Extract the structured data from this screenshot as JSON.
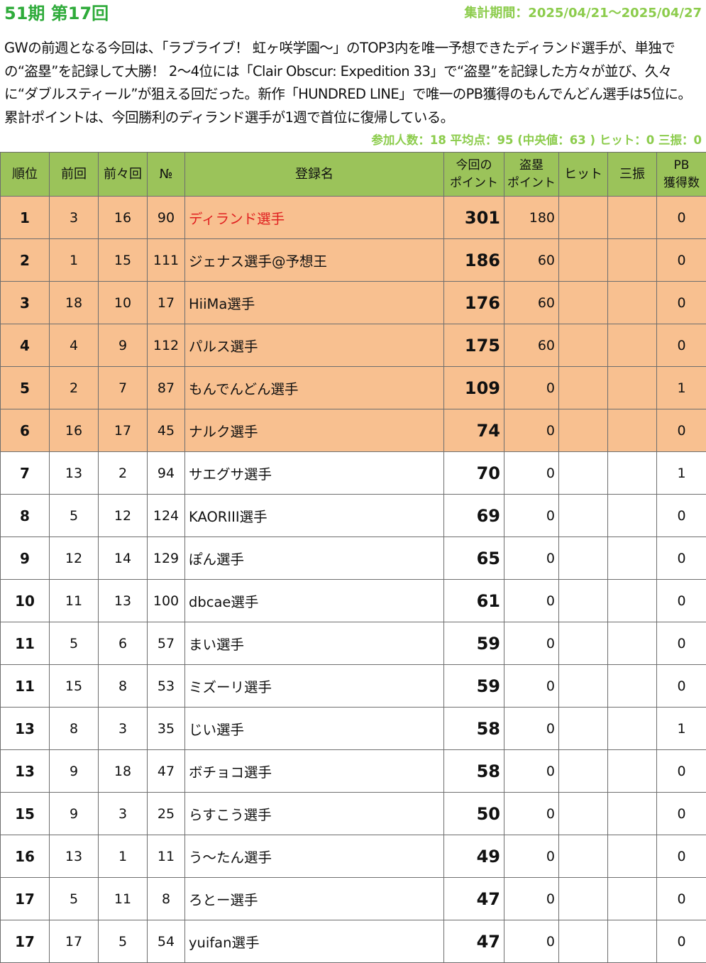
{
  "header": {
    "title": "51期 第17回",
    "period": "集計期間：2025/04/21～2025/04/27"
  },
  "summary": "GWの前週となる今回は、「ラブライブ！ 虹ヶ咲学園～」のTOP3内を唯一予想できたディランド選手が、単独での“盗塁”を記録して大勝！ 2～4位には「Clair Obscur: Expedition 33」で“盗塁”を記録した方々が並び、久々に“ダブルスティール”が狙える回だった。新作「HUNDRED LINE」で唯一のPB獲得のもんでんどん選手は5位に。累計ポイントは、今回勝利のディランド選手が1週で首位に復帰している。",
  "stats": "参加人数：18 平均点：95 (中央値：63 ) ヒット：0 三振：0",
  "colors": {
    "title": "#2eab3a",
    "accent_light_green": "#8ccc4c",
    "header_bg": "#9bc35a",
    "top_row_bg": "#f8c090",
    "winner_name": "#e02020"
  },
  "table": {
    "columns": {
      "rank": "順位",
      "prev": "前回",
      "prev2": "前々回",
      "no": "№",
      "name": "登録名",
      "points_line1": "今回の",
      "points_line2": "ポイント",
      "steal_line1": "盗塁",
      "steal_line2": "ポイント",
      "hit": "ヒット",
      "strikeout": "三振",
      "pb_line1": "PB",
      "pb_line2": "獲得数"
    },
    "rows": [
      {
        "rank": "1",
        "prev": "3",
        "prev2": "16",
        "no": "90",
        "name": "ディランド選手",
        "points": "301",
        "steal": "180",
        "hit": "",
        "strikeout": "",
        "pb": "0",
        "highlight": true,
        "winner": true
      },
      {
        "rank": "2",
        "prev": "1",
        "prev2": "15",
        "no": "111",
        "name": "ジェナス選手@予想王",
        "points": "186",
        "steal": "60",
        "hit": "",
        "strikeout": "",
        "pb": "0",
        "highlight": true
      },
      {
        "rank": "3",
        "prev": "18",
        "prev2": "10",
        "no": "17",
        "name": "HiiMa選手",
        "points": "176",
        "steal": "60",
        "hit": "",
        "strikeout": "",
        "pb": "0",
        "highlight": true
      },
      {
        "rank": "4",
        "prev": "4",
        "prev2": "9",
        "no": "112",
        "name": "パルス選手",
        "points": "175",
        "steal": "60",
        "hit": "",
        "strikeout": "",
        "pb": "0",
        "highlight": true
      },
      {
        "rank": "5",
        "prev": "2",
        "prev2": "7",
        "no": "87",
        "name": "もんでんどん選手",
        "points": "109",
        "steal": "0",
        "hit": "",
        "strikeout": "",
        "pb": "1",
        "highlight": true
      },
      {
        "rank": "6",
        "prev": "16",
        "prev2": "17",
        "no": "45",
        "name": "ナルク選手",
        "points": "74",
        "steal": "0",
        "hit": "",
        "strikeout": "",
        "pb": "0",
        "highlight": true
      },
      {
        "rank": "7",
        "prev": "13",
        "prev2": "2",
        "no": "94",
        "name": "サエグサ選手",
        "points": "70",
        "steal": "0",
        "hit": "",
        "strikeout": "",
        "pb": "1"
      },
      {
        "rank": "8",
        "prev": "5",
        "prev2": "12",
        "no": "124",
        "name": "KAORIII選手",
        "points": "69",
        "steal": "0",
        "hit": "",
        "strikeout": "",
        "pb": "0"
      },
      {
        "rank": "9",
        "prev": "12",
        "prev2": "14",
        "no": "129",
        "name": "ぽん選手",
        "points": "65",
        "steal": "0",
        "hit": "",
        "strikeout": "",
        "pb": "0"
      },
      {
        "rank": "10",
        "prev": "11",
        "prev2": "13",
        "no": "100",
        "name": "dbcae選手",
        "points": "61",
        "steal": "0",
        "hit": "",
        "strikeout": "",
        "pb": "0"
      },
      {
        "rank": "11",
        "prev": "5",
        "prev2": "6",
        "no": "57",
        "name": "まい選手",
        "points": "59",
        "steal": "0",
        "hit": "",
        "strikeout": "",
        "pb": "0"
      },
      {
        "rank": "11",
        "prev": "15",
        "prev2": "8",
        "no": "53",
        "name": "ミズーリ選手",
        "points": "59",
        "steal": "0",
        "hit": "",
        "strikeout": "",
        "pb": "0"
      },
      {
        "rank": "13",
        "prev": "8",
        "prev2": "3",
        "no": "35",
        "name": "じい選手",
        "points": "58",
        "steal": "0",
        "hit": "",
        "strikeout": "",
        "pb": "1"
      },
      {
        "rank": "13",
        "prev": "9",
        "prev2": "18",
        "no": "47",
        "name": "ボチョコ選手",
        "points": "58",
        "steal": "0",
        "hit": "",
        "strikeout": "",
        "pb": "0"
      },
      {
        "rank": "15",
        "prev": "9",
        "prev2": "3",
        "no": "25",
        "name": "らすこう選手",
        "points": "50",
        "steal": "0",
        "hit": "",
        "strikeout": "",
        "pb": "0"
      },
      {
        "rank": "16",
        "prev": "13",
        "prev2": "1",
        "no": "11",
        "name": "う～たん選手",
        "points": "49",
        "steal": "0",
        "hit": "",
        "strikeout": "",
        "pb": "0"
      },
      {
        "rank": "17",
        "prev": "5",
        "prev2": "11",
        "no": "8",
        "name": "ろとー選手",
        "points": "47",
        "steal": "0",
        "hit": "",
        "strikeout": "",
        "pb": "0"
      },
      {
        "rank": "17",
        "prev": "17",
        "prev2": "5",
        "no": "54",
        "name": "yuifan選手",
        "points": "47",
        "steal": "0",
        "hit": "",
        "strikeout": "",
        "pb": "0"
      }
    ]
  }
}
